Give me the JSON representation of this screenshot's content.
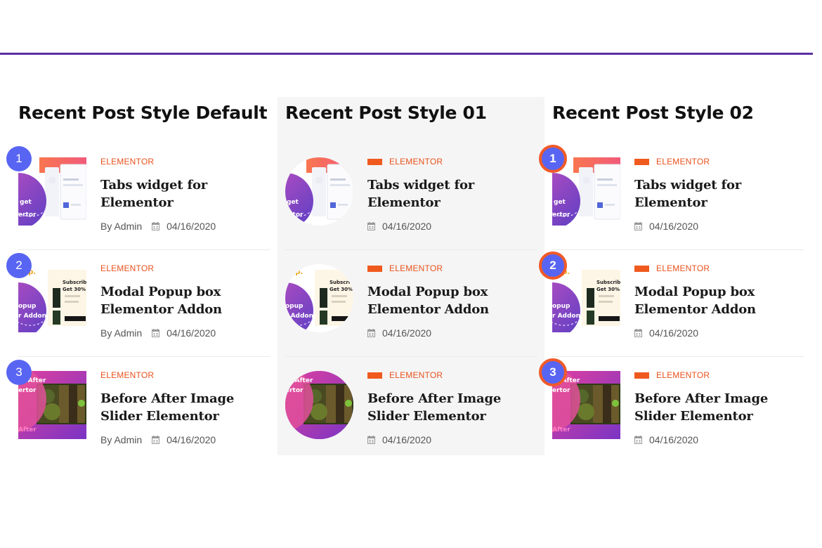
{
  "columns": [
    {
      "title": "Recent Post Style Default",
      "posts": [
        {
          "rank": "1",
          "category": "ELEMENTOR",
          "title": "Tabs widget for Elementor",
          "author": "By Admin",
          "date": "04/16/2020",
          "thumb": "tabs-widget"
        },
        {
          "rank": "2",
          "category": "ELEMENTOR",
          "title": "Modal Popup box Elementor Addon",
          "author": "By Admin",
          "date": "04/16/2020",
          "thumb": "modal-popup"
        },
        {
          "rank": "3",
          "category": "ELEMENTOR",
          "title": "Before After Image Slider Elementor",
          "author": "By Admin",
          "date": "04/16/2020",
          "thumb": "before-after"
        }
      ]
    },
    {
      "title": "Recent Post Style 01",
      "posts": [
        {
          "category": "ELEMENTOR",
          "title": "Tabs widget for Elementor",
          "date": "04/16/2020",
          "thumb": "tabs-widget"
        },
        {
          "category": "ELEMENTOR",
          "title": "Modal Popup box Elementor Addon",
          "date": "04/16/2020",
          "thumb": "modal-popup"
        },
        {
          "category": "ELEMENTOR",
          "title": "Before After Image Slider Elementor",
          "date": "04/16/2020",
          "thumb": "before-after"
        }
      ]
    },
    {
      "title": "Recent Post Style 02",
      "posts": [
        {
          "rank": "1",
          "category": "ELEMENTOR",
          "title": "Tabs widget for Elementor",
          "date": "04/16/2020",
          "thumb": "tabs-widget"
        },
        {
          "rank": "2",
          "category": "ELEMENTOR",
          "title": "Modal Popup box Elementor Addon",
          "date": "04/16/2020",
          "thumb": "modal-popup"
        },
        {
          "rank": "3",
          "category": "ELEMENTOR",
          "title": "Before After Image Slider Elementor",
          "date": "04/16/2020",
          "thumb": "before-after"
        }
      ]
    }
  ],
  "thumb_text": {
    "tabs": [
      "get",
      "ertor"
    ],
    "modal": [
      "pup.",
      "Subscrib",
      "Get 30%",
      "opup",
      "r Addon"
    ],
    "before_after": [
      "re After",
      "ertor",
      "After"
    ]
  },
  "colors": {
    "accent_line": "#5b2fa3",
    "category": "#e8521d",
    "badge": "#5865f2",
    "badge_ring": "#f05a28",
    "style01_bg": "#f5f5f5"
  },
  "icons": {
    "date": "calendar-icon"
  }
}
